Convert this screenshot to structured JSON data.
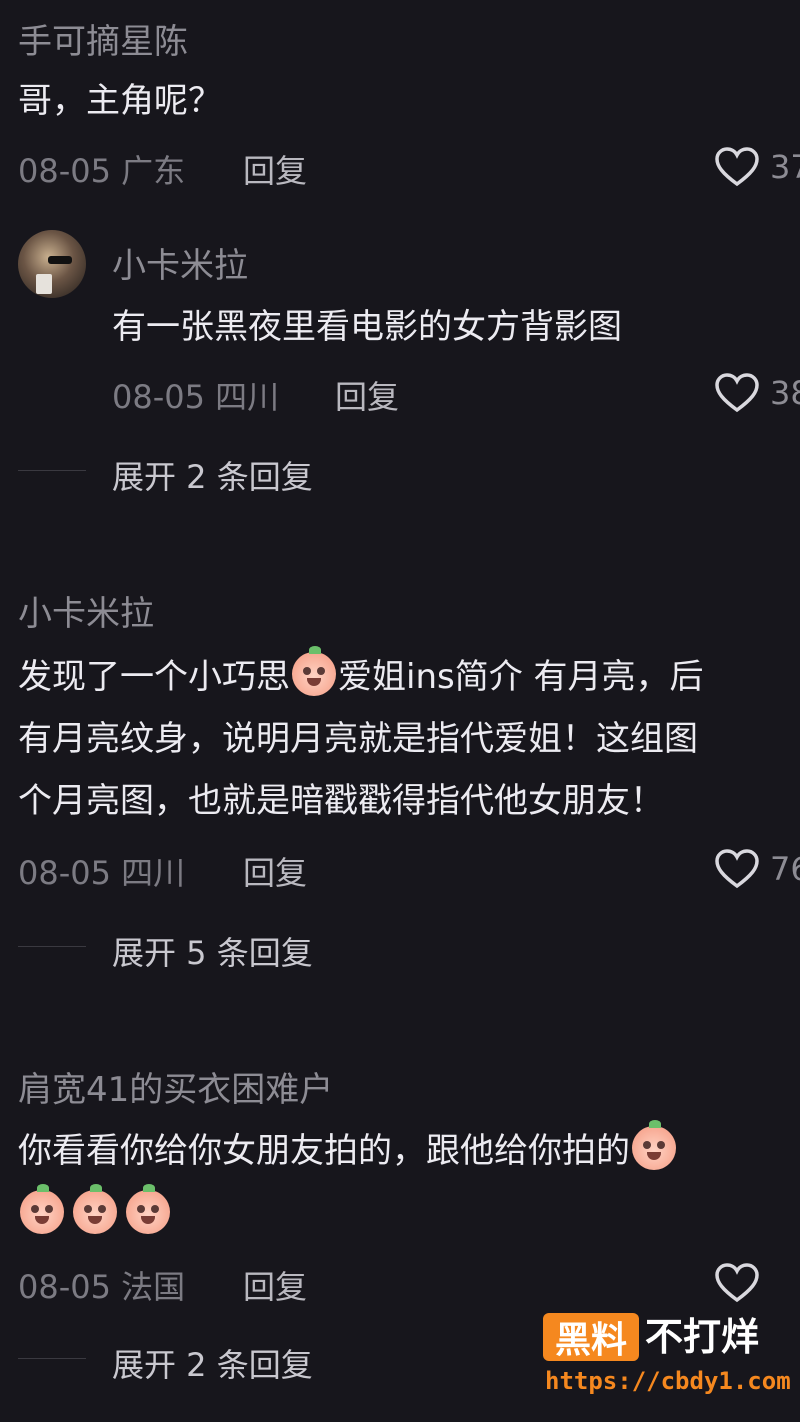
{
  "comments": [
    {
      "username": "手可摘星陈",
      "text": "哥，主角呢？",
      "date": "08-05",
      "location": "广东",
      "reply_label": "回复",
      "likes": "37"
    },
    {
      "username": "小卡米拉",
      "text": "有一张黑夜里看电影的女方背影图",
      "date": "08-05",
      "location": "四川",
      "reply_label": "回复",
      "likes": "38",
      "expand_label": "展开 2 条回复"
    },
    {
      "username": "小卡米拉",
      "text_line1_a": "发现了一个小巧思",
      "text_line1_b": "爱姐ins简介 有月亮，",
      "text_line1_c": "后",
      "text_line2": "有月亮纹身，说明月亮就是指代爱姐！这组图",
      "text_line3": "个月亮图，也就是暗戳戳得指代他女朋友！",
      "date": "08-05",
      "location": "四川",
      "reply_label": "回复",
      "likes": "76",
      "expand_label": "展开 5 条回复"
    },
    {
      "username": "肩宽41的买衣困难户",
      "text_line1": "你看看你给你女朋友拍的，跟他给你拍的",
      "date": "08-05",
      "location": "法国",
      "reply_label": "回复",
      "expand_label": "展开 2 条回复"
    }
  ],
  "watermark": {
    "brand_box": "黑料",
    "brand_text": "不打烊",
    "url": "https://cbdy1.com"
  }
}
